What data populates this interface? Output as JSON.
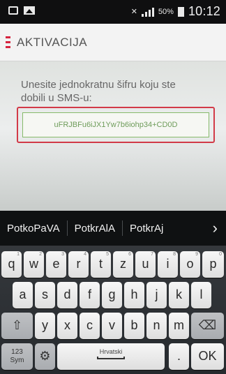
{
  "status_bar": {
    "time": "10:12",
    "battery": "50%",
    "icons": [
      "notification-icon",
      "image-icon",
      "mute-icon",
      "signal-icon",
      "battery-icon"
    ]
  },
  "app_bar": {
    "title": "AKTIVACIJA",
    "accent_color": "#d6243f"
  },
  "content": {
    "instruction": "Unesite jednokratnu šifru koju ste dobili u SMS-u:",
    "code_value": "uFRJBFu6iJX1Yw7b6iohp34+CD0D",
    "highlight_color": "#d23a48"
  },
  "suggestions": {
    "items": [
      "PotkoPaVA",
      "PotkrAlA",
      "PotkrAj"
    ],
    "more": "›"
  },
  "keyboard": {
    "row1": [
      {
        "k": "q",
        "h": "1"
      },
      {
        "k": "w",
        "h": "2"
      },
      {
        "k": "e",
        "h": "3"
      },
      {
        "k": "r",
        "h": "4"
      },
      {
        "k": "t",
        "h": "5"
      },
      {
        "k": "z",
        "h": "6"
      },
      {
        "k": "u",
        "h": "7"
      },
      {
        "k": "i",
        "h": "8"
      },
      {
        "k": "o",
        "h": "9"
      },
      {
        "k": "p",
        "h": "0"
      }
    ],
    "row2": [
      "a",
      "s",
      "d",
      "f",
      "g",
      "h",
      "j",
      "k",
      "l"
    ],
    "row3": [
      "y",
      "x",
      "c",
      "v",
      "b",
      "n",
      "m"
    ],
    "shift": "⇧",
    "backspace": "⌫",
    "sym_label": "123\nSym",
    "settings_icon": "gear-icon",
    "space_label": "Hrvatski",
    "period": ".",
    "ok_label": "OK"
  }
}
